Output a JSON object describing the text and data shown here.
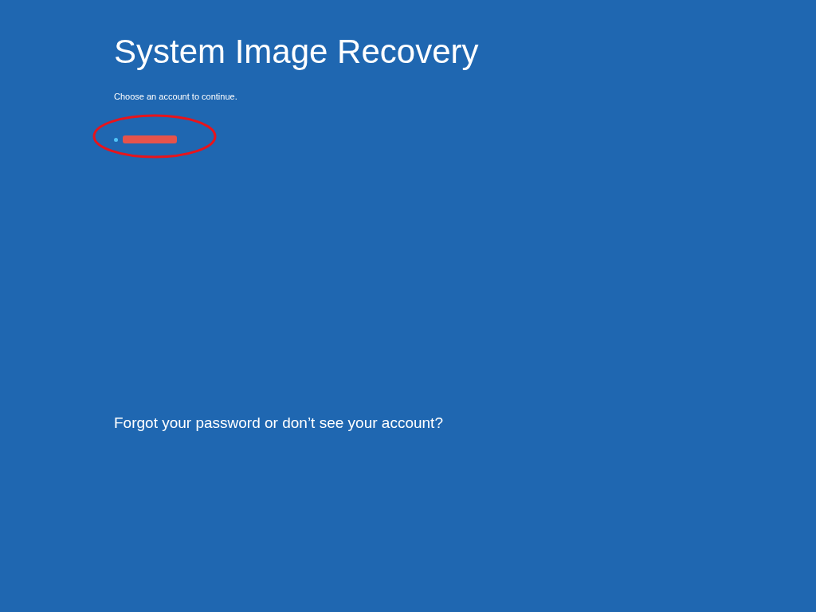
{
  "title": "System Image Recovery",
  "prompt": "Choose an account to continue.",
  "accounts": [
    {
      "selected": true
    }
  ],
  "link": "Forgot your password or don’t see your account?"
}
